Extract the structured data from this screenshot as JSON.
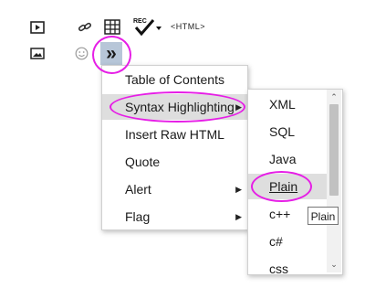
{
  "toolbar": {
    "icons": [
      "media-icon",
      "link-icon",
      "table-icon",
      "spellcheck-icon",
      "image-icon",
      "emoji-icon",
      "more-icon"
    ],
    "rec_label": "REC",
    "html_label": "<HTML>",
    "more_label": "»"
  },
  "menu": {
    "items": [
      {
        "label": "Table of Contents",
        "has_submenu": false
      },
      {
        "label": "Syntax Highlighting",
        "has_submenu": true
      },
      {
        "label": "Insert Raw HTML",
        "has_submenu": false
      },
      {
        "label": "Quote",
        "has_submenu": false
      },
      {
        "label": "Alert",
        "has_submenu": true
      },
      {
        "label": "Flag",
        "has_submenu": true
      }
    ]
  },
  "submenu": {
    "items": [
      "XML",
      "SQL",
      "Java",
      "Plain",
      "c++",
      "c#",
      "css"
    ]
  },
  "tooltip": {
    "text": "Plain"
  },
  "colors": {
    "highlight_ring": "#e61ee6",
    "more_button_bg": "#b7c6d8"
  }
}
